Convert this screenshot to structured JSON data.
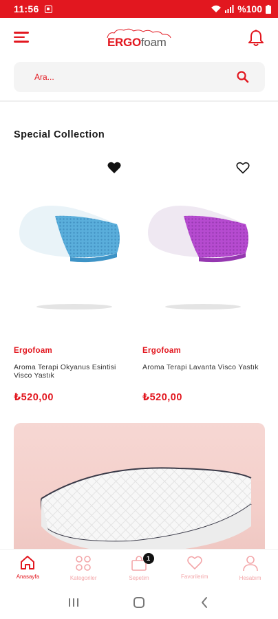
{
  "status_bar": {
    "time": "11:56",
    "battery": "%100"
  },
  "header": {
    "logo_ergo": "ERGO",
    "logo_foam": "foam"
  },
  "search": {
    "placeholder": "Ara..."
  },
  "section": {
    "title": "Special Collection"
  },
  "products": [
    {
      "brand": "Ergofoam",
      "name": "Aroma Terapi Okyanus Esintisi Visco Yastık",
      "price": "₺520,00",
      "favorite": true,
      "color": "#5aaedb"
    },
    {
      "brand": "Ergofoam",
      "name": "Aroma Terapi Lavanta Visco Yastık",
      "price": "₺520,00",
      "favorite": false,
      "color": "#b64bd0"
    }
  ],
  "bottom_nav": {
    "items": [
      {
        "label": "Anasayfa",
        "icon": "home-icon",
        "active": true
      },
      {
        "label": "Kategoriler",
        "icon": "categories-icon",
        "active": false
      },
      {
        "label": "Sepetim",
        "icon": "cart-icon",
        "active": false,
        "badge": "1"
      },
      {
        "label": "Favorilerim",
        "icon": "heart-icon",
        "active": false
      },
      {
        "label": "Hesabım",
        "icon": "user-icon",
        "active": false
      }
    ]
  },
  "colors": {
    "accent": "#e2171f",
    "inactive": "#f3a6a9",
    "banner_bg": "#f6d7d3"
  }
}
